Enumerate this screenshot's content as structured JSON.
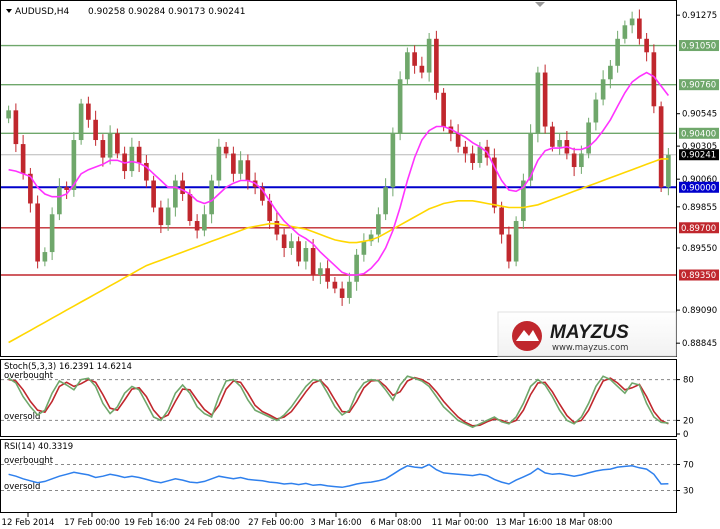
{
  "header": {
    "symbol_tf": "AUDUSD,H4",
    "ohlc": "0.90258 0.90284 0.90173 0.90241"
  },
  "watermark": {
    "brand": "MAYZUS",
    "url": "www.mayzus.com"
  },
  "colors": {
    "bull": "#6fa76b",
    "bear": "#c0272d",
    "ma_fast": "#ff33ff",
    "ma_slow": "#ffd700",
    "support_blue": "#0000cc",
    "level_red": "#c0272d",
    "level_green": "#6fa76b",
    "rsi_line": "#2f80ed",
    "stoch_main": "#6fa76b",
    "stoch_signal": "#c0272d"
  },
  "chart_data": [
    {
      "type": "candlestick",
      "title": "AUDUSD,H4",
      "ylim": [
        0.8875,
        0.9138
      ],
      "price_ticks": [
        "0.91275",
        "0.91050",
        "0.90760",
        "0.90545",
        "0.90400",
        "0.90305",
        "0.90241",
        "0.90060",
        "0.90000",
        "0.89855",
        "0.89700",
        "0.89550",
        "0.89350",
        "0.89090",
        "0.88845"
      ],
      "x_labels": [
        "12 Feb 2014",
        "17 Feb 00:00",
        "19 Feb 16:00",
        "24 Feb 08:00",
        "27 Feb 00:00",
        "3 Mar 16:00",
        "6 Mar 08:00",
        "11 Mar 00:00",
        "13 Mar 16:00",
        "18 Mar 08:00"
      ],
      "levels": [
        {
          "value": 0.9105,
          "label": "0.91050",
          "color": "green"
        },
        {
          "value": 0.9076,
          "label": "0.90760",
          "color": "green"
        },
        {
          "value": 0.904,
          "label": "0.90400",
          "color": "green"
        },
        {
          "value": 0.9,
          "label": "0.90000",
          "color": "blue"
        },
        {
          "value": 0.897,
          "label": "0.89700",
          "color": "red"
        },
        {
          "value": 0.8935,
          "label": "0.89350",
          "color": "red"
        }
      ],
      "current_price": {
        "value": 0.90241,
        "label": "0.90241"
      },
      "close": [
        0.9057,
        0.9032,
        0.901,
        0.8988,
        0.8945,
        0.8952,
        0.898,
        0.9,
        0.8998,
        0.9035,
        0.9062,
        0.905,
        0.9035,
        0.9022,
        0.904,
        0.9025,
        0.9012,
        0.903,
        0.9018,
        0.9005,
        0.8985,
        0.8972,
        0.8985,
        0.9005,
        0.8995,
        0.8975,
        0.8968,
        0.898,
        0.9005,
        0.903,
        0.9025,
        0.901,
        0.902,
        0.9005,
        0.9,
        0.899,
        0.8975,
        0.8965,
        0.8955,
        0.896,
        0.8945,
        0.8955,
        0.8935,
        0.894,
        0.893,
        0.8925,
        0.8918,
        0.893,
        0.895,
        0.896,
        0.8965,
        0.898,
        0.9,
        0.904,
        0.908,
        0.91,
        0.909,
        0.9085,
        0.911,
        0.907,
        0.9045,
        0.904,
        0.903,
        0.9025,
        0.9018,
        0.903,
        0.9022,
        0.8985,
        0.8965,
        0.8945,
        0.8975,
        0.9005,
        0.904,
        0.9085,
        0.9045,
        0.903,
        0.9035,
        0.9025,
        0.9015,
        0.9025,
        0.9048,
        0.9065,
        0.908,
        0.909,
        0.911,
        0.912,
        0.9125,
        0.911,
        0.91,
        0.906,
        0.9,
        0.9024
      ],
      "ma_fast": [
        0.9013,
        0.9012,
        0.901,
        0.9008,
        0.9,
        0.8995,
        0.8993,
        0.8993,
        0.8995,
        0.9002,
        0.901,
        0.9013,
        0.9015,
        0.9017,
        0.902,
        0.902,
        0.9018,
        0.9019,
        0.9018,
        0.9015,
        0.901,
        0.9005,
        0.9,
        0.9,
        0.8998,
        0.8995,
        0.899,
        0.8988,
        0.899,
        0.8995,
        0.9,
        0.9003,
        0.9005,
        0.9005,
        0.9003,
        0.8998,
        0.899,
        0.8982,
        0.8975,
        0.897,
        0.8965,
        0.8962,
        0.8958,
        0.8952,
        0.8947,
        0.8942,
        0.8937,
        0.8935,
        0.8935,
        0.8936,
        0.894,
        0.8946,
        0.8955,
        0.8968,
        0.8985,
        0.9005,
        0.9022,
        0.9035,
        0.9042,
        0.9045,
        0.9045,
        0.9043,
        0.904,
        0.9037,
        0.9033,
        0.903,
        0.9026,
        0.9015,
        0.9005,
        0.8998,
        0.8997,
        0.9,
        0.9008,
        0.902,
        0.9027,
        0.9029,
        0.9029,
        0.903,
        0.9028,
        0.9028,
        0.903,
        0.9035,
        0.9042,
        0.905,
        0.906,
        0.907,
        0.9078,
        0.9082,
        0.9085,
        0.9082,
        0.9075,
        0.9068
      ],
      "ma_slow": [
        0.8885,
        0.8888,
        0.8891,
        0.8894,
        0.8897,
        0.89,
        0.8903,
        0.8906,
        0.8909,
        0.8912,
        0.8915,
        0.8918,
        0.8921,
        0.8924,
        0.8927,
        0.893,
        0.8933,
        0.8936,
        0.8939,
        0.8942,
        0.8944,
        0.8946,
        0.8948,
        0.895,
        0.8952,
        0.8954,
        0.8956,
        0.8958,
        0.896,
        0.8962,
        0.8964,
        0.8966,
        0.8968,
        0.897,
        0.8971,
        0.8972,
        0.8973,
        0.8973,
        0.8972,
        0.8971,
        0.897,
        0.8969,
        0.8967,
        0.8965,
        0.8963,
        0.8961,
        0.896,
        0.8959,
        0.8959,
        0.896,
        0.8961,
        0.8963,
        0.8966,
        0.8969,
        0.8972,
        0.8975,
        0.8978,
        0.8981,
        0.8984,
        0.8986,
        0.8988,
        0.8989,
        0.899,
        0.899,
        0.899,
        0.8989,
        0.8988,
        0.8987,
        0.8986,
        0.8985,
        0.8985,
        0.8985,
        0.8986,
        0.8987,
        0.8989,
        0.8991,
        0.8993,
        0.8995,
        0.8997,
        0.8999,
        0.9001,
        0.9003,
        0.9005,
        0.9007,
        0.9009,
        0.9011,
        0.9013,
        0.9015,
        0.9017,
        0.9019,
        0.9021,
        0.9021
      ]
    },
    {
      "type": "line",
      "title": "Stoch(5,3,3) 16.2391 14.6214",
      "ylim": [
        0,
        100
      ],
      "levels": [
        {
          "value": 80,
          "label": "overbought",
          "tick": "80"
        },
        {
          "value": 20,
          "label": "oversold",
          "tick": "20"
        }
      ],
      "y_ticks": [
        "80",
        "20",
        "0"
      ],
      "series": [
        {
          "name": "main",
          "values": [
            82,
            75,
            55,
            40,
            28,
            35,
            60,
            78,
            72,
            65,
            80,
            82,
            70,
            45,
            30,
            40,
            60,
            70,
            65,
            45,
            25,
            20,
            35,
            60,
            72,
            60,
            40,
            30,
            25,
            55,
            78,
            80,
            70,
            50,
            35,
            30,
            25,
            20,
            28,
            40,
            55,
            70,
            80,
            78,
            60,
            40,
            28,
            35,
            60,
            75,
            80,
            78,
            65,
            50,
            72,
            85,
            82,
            78,
            70,
            55,
            40,
            30,
            20,
            15,
            10,
            15,
            20,
            25,
            18,
            15,
            25,
            45,
            70,
            80,
            72,
            55,
            35,
            20,
            15,
            25,
            45,
            70,
            85,
            80,
            70,
            60,
            75,
            72,
            45,
            25,
            17,
            16
          ]
        },
        {
          "name": "signal",
          "values": [
            80,
            78,
            65,
            48,
            35,
            32,
            48,
            70,
            76,
            70,
            74,
            80,
            76,
            58,
            38,
            35,
            50,
            66,
            68,
            55,
            35,
            23,
            28,
            48,
            66,
            65,
            50,
            36,
            28,
            42,
            66,
            78,
            76,
            60,
            42,
            33,
            28,
            22,
            25,
            33,
            47,
            62,
            75,
            79,
            68,
            50,
            33,
            32,
            48,
            68,
            78,
            79,
            70,
            57,
            62,
            78,
            83,
            80,
            74,
            62,
            48,
            36,
            25,
            17,
            12,
            13,
            18,
            22,
            20,
            16,
            20,
            35,
            58,
            75,
            76,
            62,
            44,
            27,
            17,
            20,
            35,
            58,
            78,
            82,
            75,
            65,
            68,
            73,
            55,
            33,
            20,
            15
          ]
        }
      ]
    },
    {
      "type": "line",
      "title": "RSI(14) 40.3319",
      "ylim": [
        0,
        100
      ],
      "levels": [
        {
          "value": 70,
          "label": "overbought",
          "tick": "70"
        },
        {
          "value": 30,
          "label": "oversold",
          "tick": "30"
        }
      ],
      "y_ticks": [
        "70",
        "30"
      ],
      "series": [
        {
          "name": "RSI(14)",
          "values": [
            55,
            52,
            48,
            45,
            42,
            44,
            48,
            52,
            55,
            58,
            56,
            54,
            50,
            52,
            55,
            53,
            50,
            52,
            50,
            47,
            44,
            42,
            45,
            48,
            46,
            43,
            42,
            44,
            48,
            52,
            50,
            48,
            50,
            47,
            46,
            45,
            43,
            42,
            40,
            41,
            39,
            41,
            38,
            39,
            37,
            36,
            35,
            37,
            40,
            42,
            43,
            45,
            48,
            55,
            62,
            68,
            66,
            65,
            70,
            62,
            57,
            56,
            55,
            54,
            53,
            55,
            53,
            47,
            43,
            40,
            46,
            51,
            56,
            64,
            57,
            55,
            56,
            54,
            52,
            54,
            57,
            60,
            62,
            63,
            66,
            67,
            68,
            65,
            63,
            55,
            40,
            40.3
          ]
        }
      ]
    }
  ]
}
